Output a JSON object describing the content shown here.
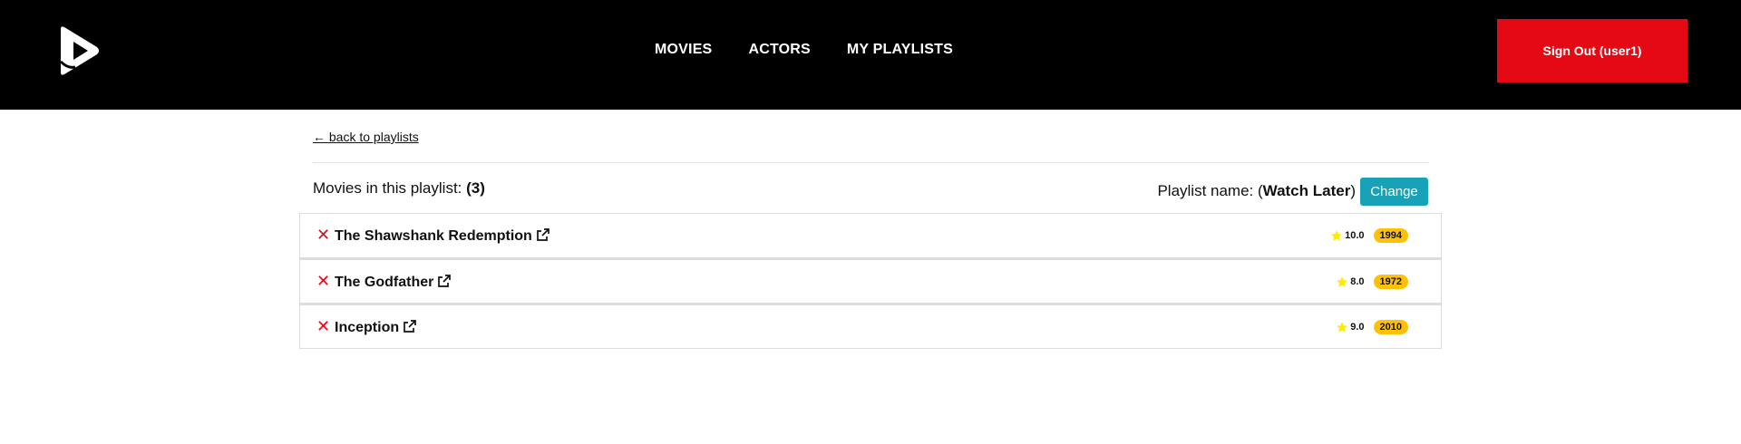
{
  "header": {
    "nav": [
      "MOVIES",
      "ACTORS",
      "MY PLAYLISTS"
    ],
    "signout_label": "Sign Out (user1)"
  },
  "content": {
    "back_label": "← back to playlists",
    "count_prefix": "Movies in this playlist: ",
    "count_value": "(3)",
    "playlist_prefix": "Playlist name: (",
    "playlist_name": "Watch Later",
    "playlist_suffix": ")",
    "change_label": "Change"
  },
  "movies": [
    {
      "title": "The Shawshank Redemption",
      "rating": "10.0",
      "year": "1994"
    },
    {
      "title": "The Godfather",
      "rating": "8.0",
      "year": "1972"
    },
    {
      "title": "Inception",
      "rating": "9.0",
      "year": "2010"
    }
  ],
  "icons": {
    "remove": "close-icon",
    "external": "external-link-icon",
    "rating": "star-icon"
  },
  "colors": {
    "header_bg": "#000000",
    "signout": "#e50914",
    "change": "#17a2b8",
    "year_badge": "#ffc107",
    "star": "#ffeb00"
  }
}
